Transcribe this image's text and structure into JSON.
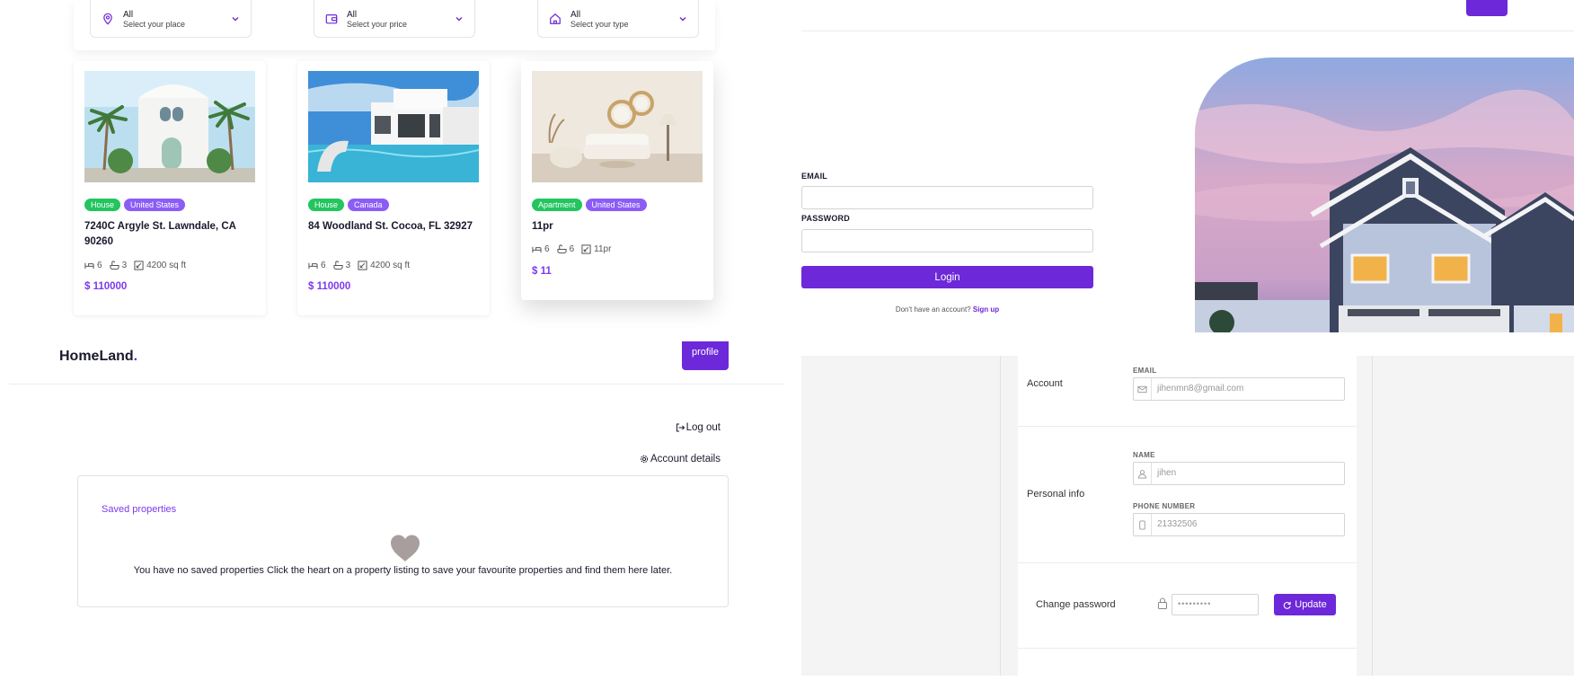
{
  "filters": [
    {
      "value": "All",
      "label": "Select your place",
      "icon": "location-pin-icon"
    },
    {
      "value": "All",
      "label": "Select your price",
      "icon": "wallet-icon"
    },
    {
      "value": "All",
      "label": "Select your type",
      "icon": "home-icon"
    }
  ],
  "listings": [
    {
      "tags": [
        "House",
        "United States"
      ],
      "title": "7240C Argyle St. Lawndale, CA 90260",
      "beds": "6",
      "baths": "3",
      "area": "4200 sq ft",
      "price": "$ 110000"
    },
    {
      "tags": [
        "House",
        "Canada"
      ],
      "title": "84 Woodland St. Cocoa, FL 32927",
      "beds": "6",
      "baths": "3",
      "area": "4200 sq ft",
      "price": "$ 110000"
    },
    {
      "tags": [
        "Apartment",
        "United States"
      ],
      "title": "11pr",
      "beds": "6",
      "baths": "6",
      "area": "11pr",
      "price": "$ 11"
    }
  ],
  "login": {
    "email_label": "EMAIL",
    "password_label": "PASSWORD",
    "button_label": "Login",
    "no_account_text": "Don't have an account?",
    "signup_label": "Sign up"
  },
  "profile": {
    "brand": "HomeLand",
    "brand_dot": ".",
    "profile_button": "profile",
    "logout_label": "Log out",
    "account_details_label": "Account details",
    "saved_title": "Saved properties",
    "saved_message": "You have no saved properties Click the heart on a property listing to save your favourite properties and find them here later."
  },
  "account": {
    "account_section": "Account",
    "email_label": "EMAIL",
    "email_value": "jihenmn8@gmail.com",
    "personal_section": "Personal info",
    "name_label": "NAME",
    "name_value": "jihen",
    "phone_label": "PHONE NUMBER",
    "phone_value": "21332506",
    "password_section": "Change password",
    "password_value": "•••••••••",
    "update_button": "Update"
  },
  "colors": {
    "accent": "#6d28d9",
    "tag_green": "#22c55e",
    "tag_purple": "#8b5cf6",
    "price": "#7c3aed"
  }
}
